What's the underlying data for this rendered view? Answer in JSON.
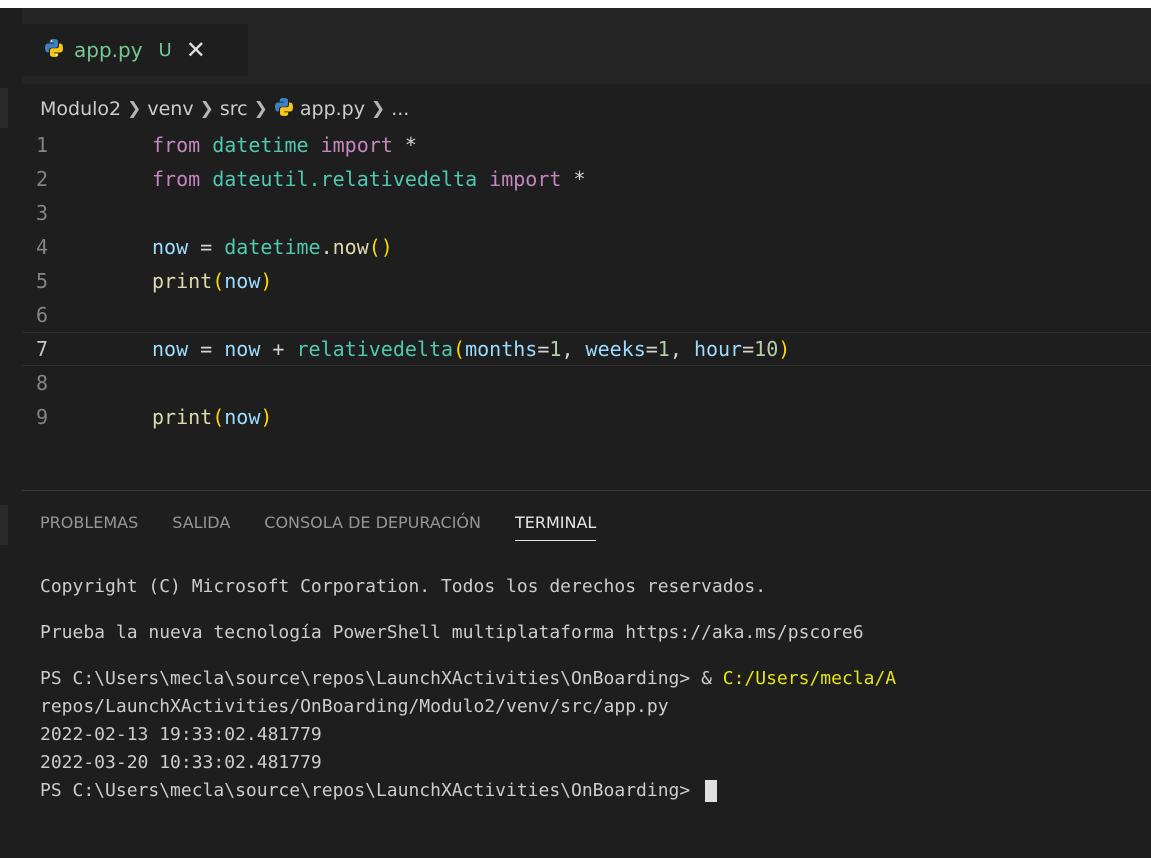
{
  "tab": {
    "filename": "app.py",
    "status": "U",
    "close": "✕"
  },
  "breadcrumb": [
    "Modulo2",
    "venv",
    "src",
    "app.py",
    "..."
  ],
  "editor": {
    "lines": [
      {
        "n": "1",
        "tokens": [
          [
            "kw",
            "from"
          ],
          [
            "op",
            " "
          ],
          [
            "mod",
            "datetime"
          ],
          [
            "op",
            " "
          ],
          [
            "kw",
            "import"
          ],
          [
            "op",
            " *"
          ]
        ]
      },
      {
        "n": "2",
        "tokens": [
          [
            "kw",
            "from"
          ],
          [
            "op",
            " "
          ],
          [
            "mod",
            "dateutil.relativedelta"
          ],
          [
            "op",
            " "
          ],
          [
            "kw",
            "import"
          ],
          [
            "op",
            " *"
          ]
        ]
      },
      {
        "n": "3",
        "tokens": []
      },
      {
        "n": "4",
        "tokens": [
          [
            "var",
            "now"
          ],
          [
            "op",
            " = "
          ],
          [
            "mod",
            "datetime"
          ],
          [
            "op",
            "."
          ],
          [
            "fn",
            "now"
          ],
          [
            "br1",
            "()"
          ]
        ]
      },
      {
        "n": "5",
        "tokens": [
          [
            "fn",
            "print"
          ],
          [
            "br1",
            "("
          ],
          [
            "var",
            "now"
          ],
          [
            "br1",
            ")"
          ]
        ]
      },
      {
        "n": "6",
        "tokens": []
      },
      {
        "n": "7",
        "tokens": [
          [
            "var",
            "now"
          ],
          [
            "op",
            " = "
          ],
          [
            "var",
            "now"
          ],
          [
            "op",
            " + "
          ],
          [
            "mod",
            "relativedelta"
          ],
          [
            "br1",
            "("
          ],
          [
            "var",
            "months"
          ],
          [
            "op",
            "="
          ],
          [
            "num",
            "1"
          ],
          [
            "op",
            ", "
          ],
          [
            "var",
            "weeks"
          ],
          [
            "op",
            "="
          ],
          [
            "num",
            "1"
          ],
          [
            "op",
            ", "
          ],
          [
            "var",
            "hour"
          ],
          [
            "op",
            "="
          ],
          [
            "num",
            "10"
          ],
          [
            "br1",
            ")"
          ]
        ]
      },
      {
        "n": "8",
        "tokens": []
      },
      {
        "n": "9",
        "tokens": [
          [
            "fn",
            "print"
          ],
          [
            "br1",
            "("
          ],
          [
            "var",
            "now"
          ],
          [
            "br1",
            ")"
          ]
        ]
      }
    ],
    "active_line": "7"
  },
  "panel": {
    "tabs": [
      "PROBLEMAS",
      "SALIDA",
      "CONSOLA DE DEPURACIÓN",
      "TERMINAL"
    ],
    "active_tab": "TERMINAL"
  },
  "terminal": {
    "copyright": "Copyright (C) Microsoft Corporation. Todos los derechos reservados.",
    "try_new": "Prueba la nueva tecnología PowerShell multiplataforma https://aka.ms/pscore6",
    "prompt1": "PS C:\\Users\\mecla\\source\\repos\\LaunchXActivities\\OnBoarding> ",
    "cmd_amp": "& ",
    "cmd_path": "C:/Users/mecla/A",
    "cmd_cont": "repos/LaunchXActivities/OnBoarding/Modulo2/venv/src/app.py",
    "out1": "2022-02-13 19:33:02.481779",
    "out2": "2022-03-20 10:33:02.481779",
    "prompt2": "PS C:\\Users\\mecla\\source\\repos\\LaunchXActivities\\OnBoarding> "
  }
}
